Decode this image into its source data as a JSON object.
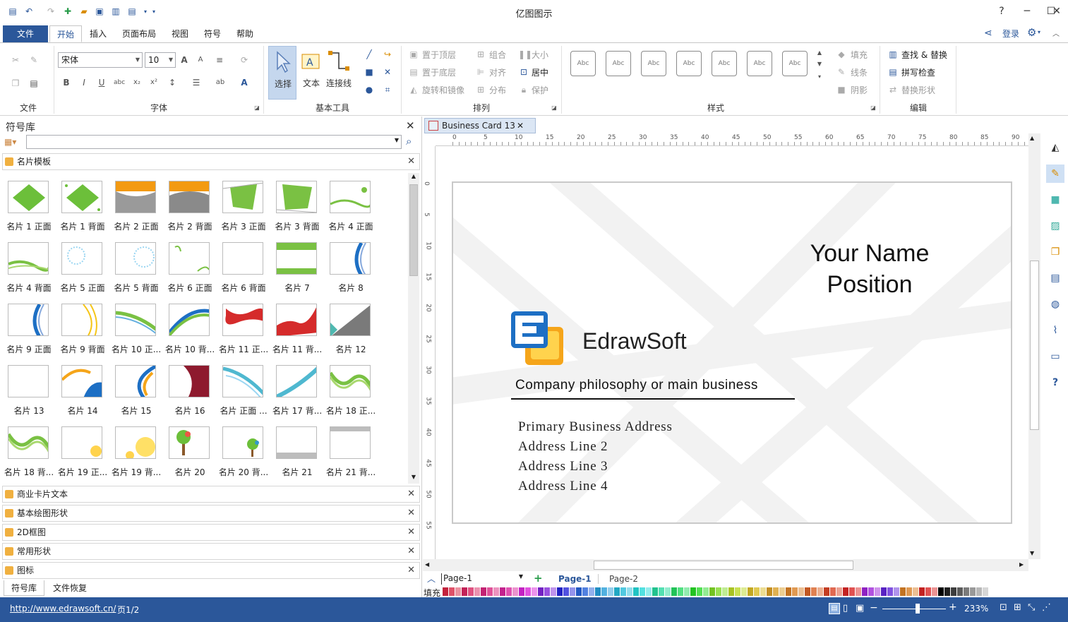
{
  "window": {
    "title": "亿图图示"
  },
  "menu": {
    "tabs": [
      "文件",
      "开始",
      "插入",
      "页面布局",
      "视图",
      "符号",
      "帮助"
    ],
    "login": "登录"
  },
  "ribbon": {
    "groups": [
      "文件",
      "字体",
      "基本工具",
      "排列",
      "样式",
      "编辑"
    ],
    "font_name": "宋体",
    "font_size": "10",
    "tools": {
      "select": "选择",
      "text": "文本",
      "connector": "连接线"
    },
    "arrange": [
      "置于顶层",
      "组合",
      "大小",
      "置于底层",
      "对齐",
      "居中",
      "旋转和镜像",
      "分布",
      "保护"
    ],
    "style_sample": "Abc",
    "style_props": [
      "填充",
      "线条",
      "阴影"
    ],
    "edit": [
      "查找 & 替换",
      "拼写检查",
      "替换形状"
    ]
  },
  "library": {
    "title": "符号库",
    "section": "名片模板",
    "shapes": [
      "名片 1 正面",
      "名片 1 背面",
      "名片 2 正面",
      "名片 2 背面",
      "名片 3 正面",
      "名片 3 背面",
      "名片 4 正面",
      "名片 4 背面",
      "名片 5 正面",
      "名片 5 背面",
      "名片 6 正面",
      "名片 6 背面",
      "名片 7",
      "名片 8",
      "名片 9 正面",
      "名片 9 背面",
      "名片 10 正...",
      "名片 10 背...",
      "名片 11 正...",
      "名片 11 背...",
      "名片 12",
      "名片 13",
      "名片 14",
      "名片 15",
      "名片 16",
      "名片 正面 ...",
      "名片 17 背...",
      "名片 18 正...",
      "名片 18 背...",
      "名片 19 正...",
      "名片 19 背...",
      "名片 20",
      "名片 20 背...",
      "名片 21",
      "名片 21 背..."
    ],
    "categories": [
      "商业卡片文本",
      "基本绘图形状",
      "2D框图",
      "常用形状",
      "图标"
    ],
    "bottom_tabs": [
      "符号库",
      "文件恢复"
    ]
  },
  "document": {
    "tab": "Business Card 13",
    "ruler_h": [
      "0",
      "5",
      "10",
      "15",
      "20",
      "25",
      "30",
      "35",
      "40",
      "45",
      "50",
      "55",
      "60",
      "65",
      "70",
      "75",
      "80",
      "85",
      "90"
    ],
    "ruler_v": [
      "0",
      "5",
      "10",
      "15",
      "20",
      "25",
      "30",
      "35",
      "40",
      "45",
      "50",
      "55"
    ],
    "card": {
      "name": "Your Name",
      "position": "Position",
      "company": "EdrawSoft",
      "slogan": "Company philosophy or main business",
      "address": [
        "Primary Business Address",
        "Address Line 2",
        "Address Line 3",
        "Address Line 4"
      ]
    }
  },
  "pages": {
    "selector": "Page-1",
    "tabs": [
      "Page-1",
      "Page-2"
    ],
    "fill_label": "填充"
  },
  "status": {
    "url": "http://www.edrawsoft.cn/",
    "page": "页1/2",
    "zoom": "233%"
  }
}
